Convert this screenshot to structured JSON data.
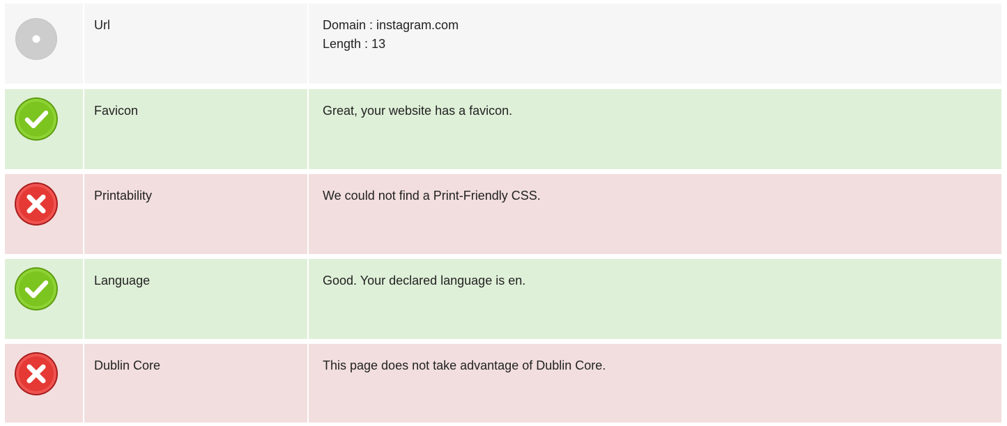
{
  "rows": [
    {
      "status": "neutral",
      "icon": "neutral-dot-icon",
      "label": "Url",
      "lines": [
        "Domain : instagram.com",
        "Length : 13"
      ]
    },
    {
      "status": "good",
      "icon": "check-icon",
      "label": "Favicon",
      "lines": [
        "Great, your website has a favicon."
      ]
    },
    {
      "status": "bad",
      "icon": "cross-icon",
      "label": "Printability",
      "lines": [
        "We could not find a Print-Friendly CSS."
      ]
    },
    {
      "status": "good",
      "icon": "check-icon",
      "label": "Language",
      "lines": [
        "Good. Your declared language is en."
      ]
    },
    {
      "status": "bad",
      "icon": "cross-icon",
      "label": "Dublin Core",
      "lines": [
        "This page does not take advantage of Dublin Core."
      ]
    }
  ],
  "colors": {
    "neutral_bg": "#f6f6f6",
    "good_bg": "#dff0d8",
    "bad_bg": "#f2dede",
    "check_green": "#7cc41f",
    "cross_red": "#e53935",
    "neutral_gray": "#c7c7c7"
  }
}
